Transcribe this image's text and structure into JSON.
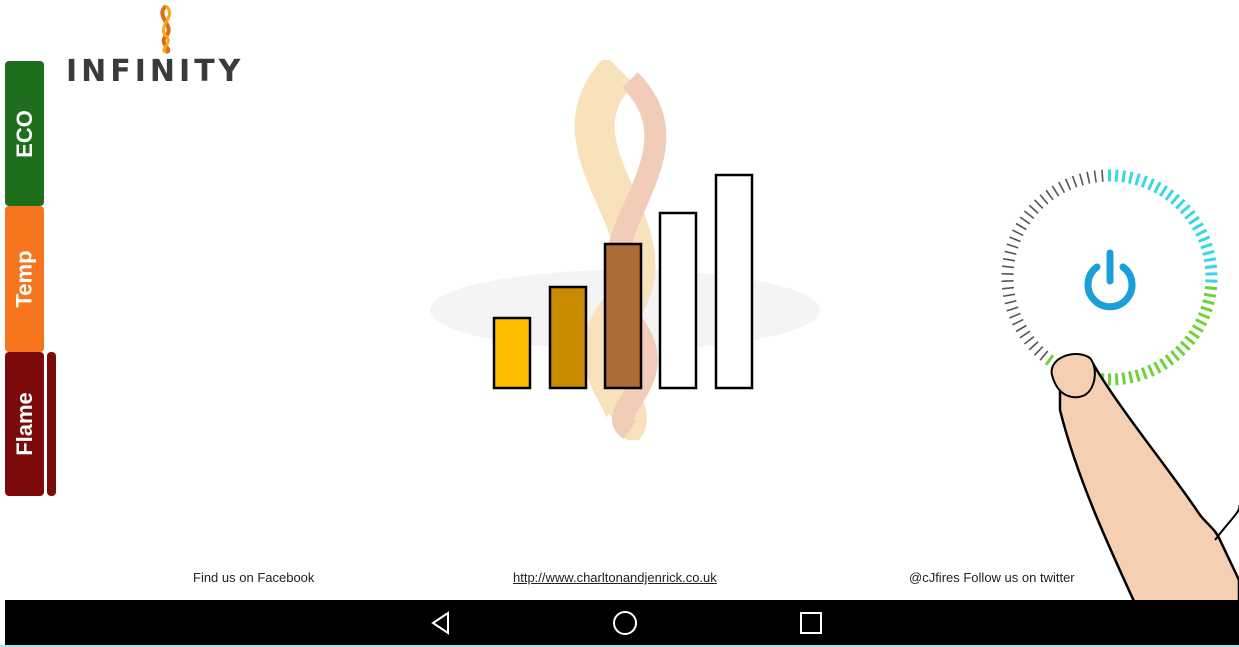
{
  "brand": {
    "logo_text": "INFINITY"
  },
  "tabs": [
    {
      "label": "ECO",
      "color": "#1e6e1e"
    },
    {
      "label": "Temp",
      "color": "#f7751e"
    },
    {
      "label": "Flame",
      "color": "#7d0a0a"
    }
  ],
  "active_tab": "Flame",
  "flame_level": {
    "value": 3,
    "max": 5,
    "bar_colors": [
      "#ffbf00",
      "#c98a00",
      "#ad6c36"
    ],
    "empty_color": "#ffffff"
  },
  "power": {
    "icon": "power-icon",
    "icon_color": "#1a9fd6",
    "ring_colors": [
      "#6cd33a",
      "#3ad6e8",
      "#555555"
    ]
  },
  "footer": {
    "facebook": "Find us on Facebook",
    "website": "http://www.charltonandjenrick.co.uk",
    "twitter": "@cJfires Follow us on twitter"
  },
  "navbar": {
    "back_icon": "back-triangle-icon",
    "home_icon": "home-circle-icon",
    "recents_icon": "recents-square-icon"
  }
}
